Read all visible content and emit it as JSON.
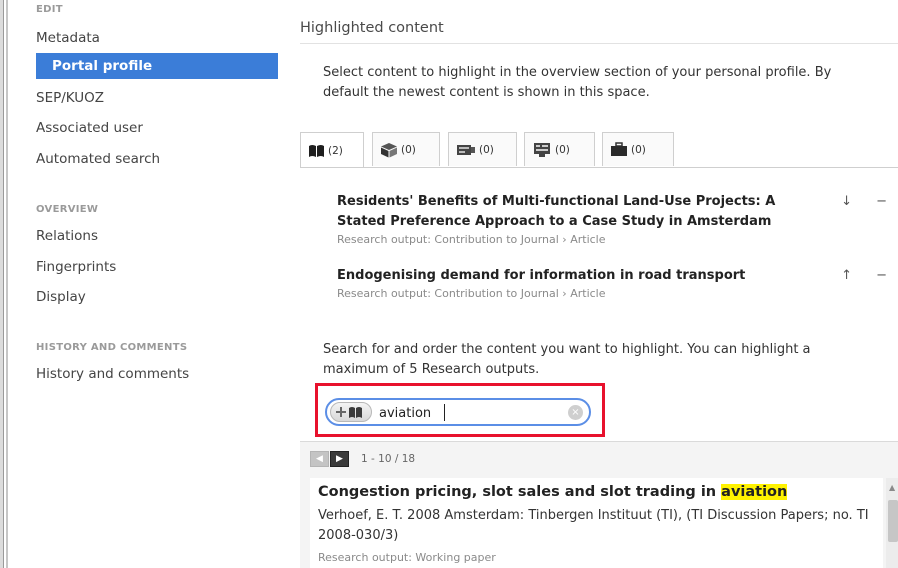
{
  "sidebar": {
    "edit_group": "EDIT",
    "items_edit": [
      "Metadata",
      "Portal profile",
      "SEP/KUOZ",
      "Associated user",
      "Automated search"
    ],
    "active": "Portal profile",
    "overview_group": "OVERVIEW",
    "items_overview": [
      "Relations",
      "Fingerprints",
      "Display"
    ],
    "history_group": "HISTORY AND COMMENTS",
    "items_history": [
      "History and comments"
    ]
  },
  "main": {
    "section_title": "Highlighted content",
    "intro_line1": "Select content to highlight in the overview section of your personal profile. By",
    "intro_line2": "default the newest content is shown in this space.",
    "tabs": [
      {
        "icon": "book-icon",
        "count": "(2)"
      },
      {
        "icon": "box-icon",
        "count": "(0)"
      },
      {
        "icon": "projector-icon",
        "count": "(0)"
      },
      {
        "icon": "dataset-icon",
        "count": "(0)"
      },
      {
        "icon": "briefcase-icon",
        "count": "(0)"
      }
    ],
    "highlighted": [
      {
        "title_line1": "Residents' Benefits of Multi-functional Land-Use Projects: A",
        "title_line2": "Stated Preference Approach to a Case Study in Amsterdam",
        "subtitle": "Research output: Contribution to Journal › Article",
        "controls": "↓ −"
      },
      {
        "title_line1": "Endogenising demand for information in road transport",
        "subtitle": "Research output: Contribution to Journal › Article",
        "controls": "↑ −"
      }
    ],
    "search_desc_line1": "Search for and order the content you want to highlight. You can highlight a",
    "search_desc_line2": "maximum of 5 Research outputs.",
    "search": {
      "value": "aviation",
      "button_icon": "add-book-icon",
      "clear": "×"
    },
    "pager": {
      "prev": "◀",
      "next": "▶",
      "text": "1 - 10 / 18"
    },
    "result": {
      "title_before": "Congestion pricing, slot sales and slot trading in ",
      "title_highlight": "aviation",
      "authors_line": "Verhoef, E. T. 2008 Amsterdam: Tinbergen Instituut (TI), (TI Discussion Papers; no. TI 2008-030/3)",
      "type": "Research output: Working paper"
    }
  }
}
